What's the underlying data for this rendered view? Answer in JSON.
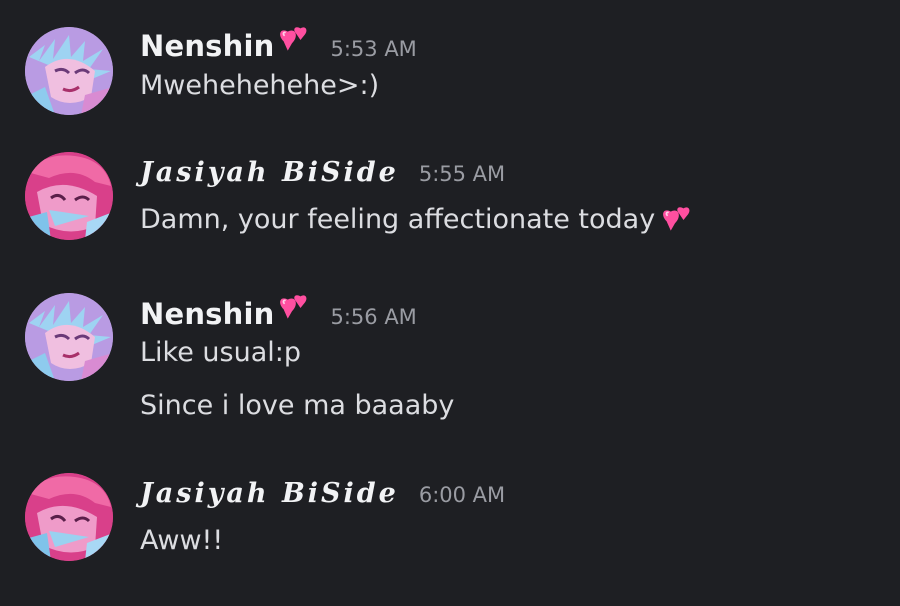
{
  "colors": {
    "background": "#1e1f23",
    "username": "#f2f3f5",
    "message_text": "#dcdde1",
    "timestamp": "#9a9ca3",
    "heart_emoji": "#ff4fa0"
  },
  "messages": [
    {
      "username": "Nenshin",
      "username_emoji": "two-hearts-icon",
      "timestamp": "5:53 AM",
      "avatar": "nenshin-avatar",
      "lines": [
        {
          "text": "Mwehehehehe>:)",
          "trailing_emoji": ""
        }
      ]
    },
    {
      "username": "Jasiyah BiSide",
      "username_emoji": "",
      "timestamp": "5:55 AM",
      "avatar": "jasiyah-avatar",
      "lines": [
        {
          "text": "Damn, your feeling affectionate today",
          "trailing_emoji": "two-hearts-icon"
        }
      ]
    },
    {
      "username": "Nenshin",
      "username_emoji": "two-hearts-icon",
      "timestamp": "5:56 AM",
      "avatar": "nenshin-avatar",
      "lines": [
        {
          "text": "Like usual:p",
          "trailing_emoji": ""
        },
        {
          "text": "Since i love ma baaaby",
          "trailing_emoji": ""
        }
      ]
    },
    {
      "username": "Jasiyah BiSide",
      "username_emoji": "",
      "timestamp": "6:00 AM",
      "avatar": "jasiyah-avatar",
      "lines": [
        {
          "text": "Aww!!",
          "trailing_emoji": ""
        }
      ]
    }
  ]
}
